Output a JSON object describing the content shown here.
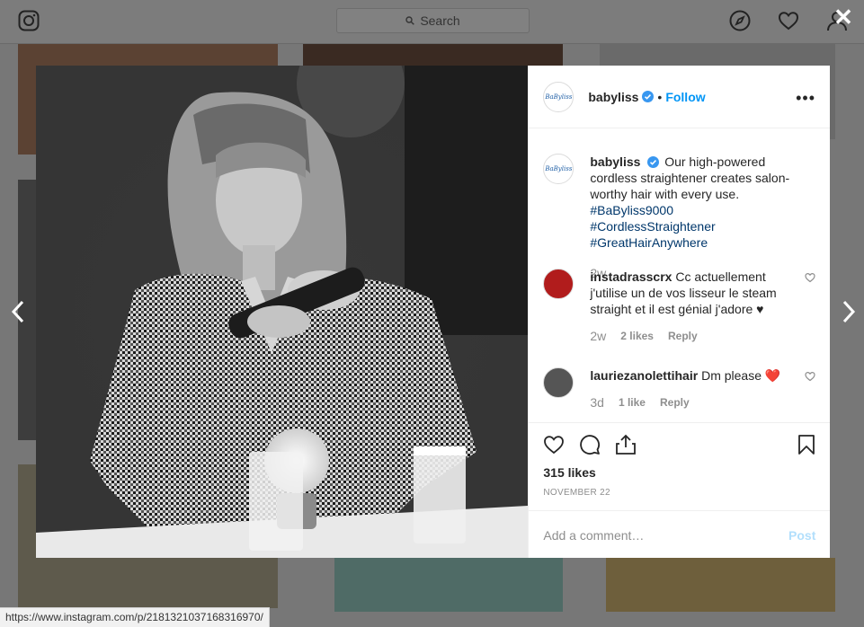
{
  "topbar": {
    "search_placeholder": "Search"
  },
  "post": {
    "username": "babyliss",
    "follow_label": "Follow",
    "caption": {
      "text": "Our high-powered cordless straightener creates salon-worthy hair with every use.",
      "hashtags": [
        "#BaByliss9000",
        "#CordlessStraightener",
        "#GreatHairAnywhere"
      ],
      "time": "2w"
    },
    "comments": [
      {
        "username": "instadrasscrx",
        "text": "Cc actuellement j'utilise un de vos lisseur le steam straight et il est génial j'adore ♥",
        "time": "2w",
        "likes": "2 likes",
        "reply": "Reply"
      },
      {
        "username": "lauriezanolettihair",
        "text": "Dm please ❤️",
        "time": "3d",
        "likes": "1 like",
        "reply": "Reply"
      }
    ],
    "likes": "315 likes",
    "date": "NOVEMBER 22",
    "add_comment_placeholder": "Add a comment…",
    "post_label": "Post"
  },
  "status_url": "https://www.instagram.com/p/2181321037168316970/",
  "colors": {
    "accent": "#0095f6",
    "hashtag": "#00376b",
    "verified": "#3897f0"
  },
  "icons": [
    "instagram-logo-icon",
    "search-icon",
    "compass-icon",
    "heart-icon",
    "profile-icon",
    "close-icon",
    "chevron-left-icon",
    "chevron-right-icon",
    "more-icon",
    "comment-icon",
    "share-icon",
    "bookmark-icon"
  ]
}
